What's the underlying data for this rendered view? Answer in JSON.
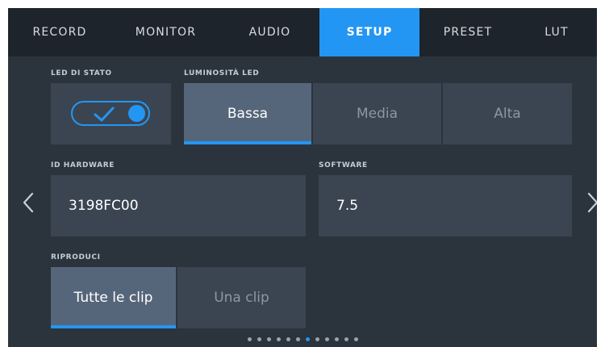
{
  "tabs": [
    {
      "label": "RECORD"
    },
    {
      "label": "MONITOR"
    },
    {
      "label": "AUDIO"
    },
    {
      "label": "SETUP",
      "active": true
    },
    {
      "label": "PRESET"
    },
    {
      "label": "LUT"
    }
  ],
  "led_status": {
    "label": "LED DI STATO",
    "enabled": true
  },
  "led_brightness": {
    "label": "LUMINOSITÀ LED",
    "options": [
      "Bassa",
      "Media",
      "Alta"
    ],
    "selected": "Bassa"
  },
  "hardware_id": {
    "label": "ID HARDWARE",
    "value": "3198FC00"
  },
  "software": {
    "label": "SOFTWARE",
    "value": "7.5"
  },
  "playback": {
    "label": "RIPRODUCI",
    "options": [
      "Tutte le clip",
      "Una clip"
    ],
    "selected": "Tutte le clip"
  },
  "pagination": {
    "total_pages": 12,
    "current_page": 7
  },
  "navigation": {
    "prev_icon": "chevron-left-icon",
    "next_icon": "chevron-right-icon"
  },
  "colors": {
    "accent": "#2396f3",
    "background": "#2b333c",
    "tabbar": "#1e242b",
    "tile": "#3b4552",
    "tile_selected": "#56667a"
  }
}
